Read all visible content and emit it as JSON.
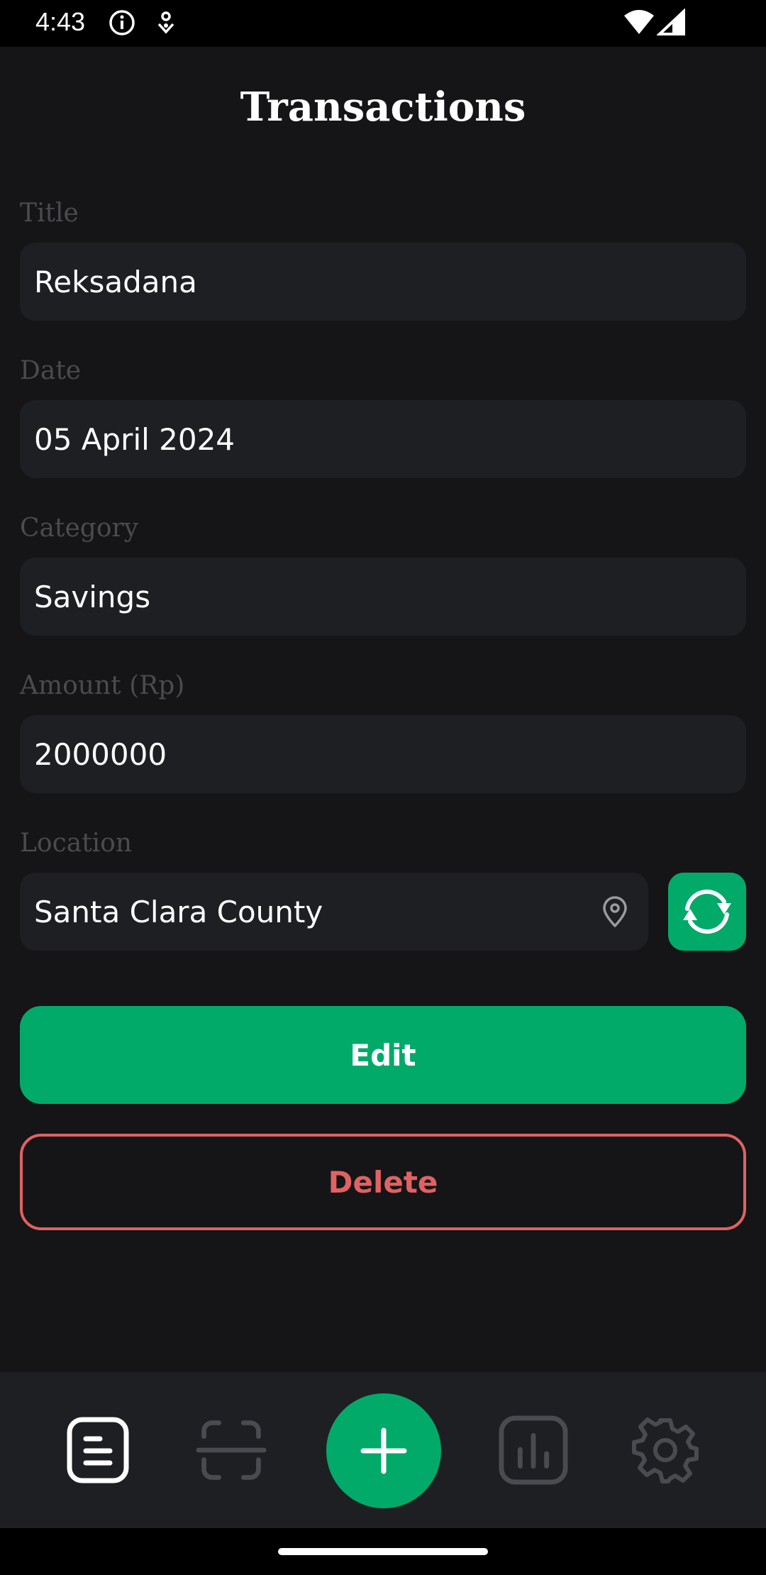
{
  "status_bar": {
    "time": "4:43",
    "icons": [
      "info-icon",
      "notification-icon",
      "wifi-icon",
      "signal-icon"
    ]
  },
  "header": {
    "title": "Transactions"
  },
  "form": {
    "title": {
      "label": "Title",
      "value": "Reksadana"
    },
    "date": {
      "label": "Date",
      "value": "05 April 2024"
    },
    "category": {
      "label": "Category",
      "value": "Savings"
    },
    "amount": {
      "label": "Amount (Rp)",
      "value": "2000000"
    },
    "location": {
      "label": "Location",
      "value": "Santa Clara County"
    }
  },
  "actions": {
    "edit_label": "Edit",
    "delete_label": "Delete"
  },
  "bottom_nav": {
    "items": [
      "transactions-icon",
      "scan-icon",
      "add-icon",
      "stats-icon",
      "settings-icon"
    ],
    "active": "transactions-icon"
  },
  "colors": {
    "accent": "#02aa6a",
    "danger": "#e06262",
    "background": "#151517",
    "field": "#1e1f23",
    "label": "#4b4b4f"
  }
}
